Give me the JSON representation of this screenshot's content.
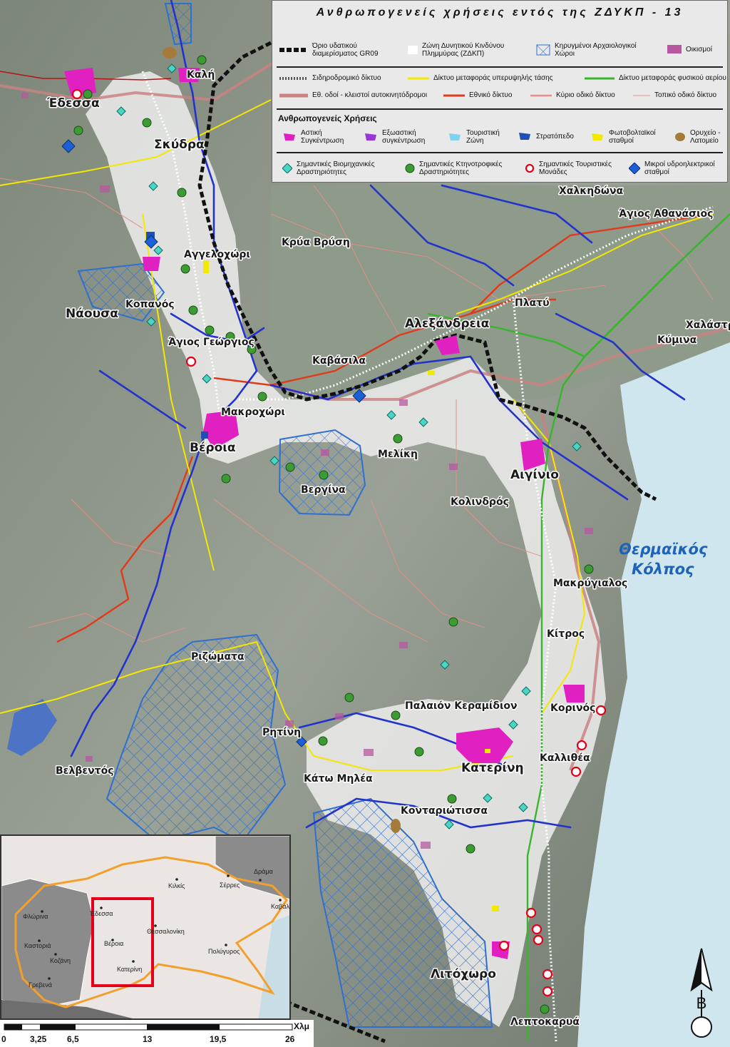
{
  "legend": {
    "title": "Ανθρωπογενείς χρήσεις εντός της ΖΔΥΚΠ - 13",
    "row1": {
      "boundary": "Όριο υδατικού διαμερίσματος GR09",
      "flood_zone": "Ζώνη Δυνητικού Κινδύνου Πλημμύρας (ΖΔΚΠ)",
      "archaeological": "Κηρυγμένοι Αρχαιολογικοί Χώροι",
      "settlements": "Οικισμοί"
    },
    "row2": {
      "railway": "Σιδηροδρομικό δίκτυο",
      "high_voltage": "Δίκτυο μεταφοράς υπερυψηλής τάσης",
      "gas_network": "Δίκτυο μεταφοράς φυσικού αερίου",
      "motorways": "Εθ. οδοί - κλειστοί αυτοκινητόδρομοι",
      "national_network": "Εθνικό δίκτυο",
      "main_roads": "Κύριο οδικό δίκτυο",
      "local_roads": "Τοπικό οδικό δίκτυο"
    },
    "uses_header": "Ανθρωπογενείς Χρήσεις",
    "uses": {
      "urban": "Αστική Συγκέντρωση",
      "suburban": "Εξωαστική συγκέντρωση",
      "tourist": "Τουριστική Ζώνη",
      "military": "Στρατόπεδο",
      "pv": "Φωτοβολταϊκοί σταθμοί",
      "quarry": "Ορυχείο - Λατομείο"
    },
    "points": {
      "industrial": "Σημαντικές Βιομηχανικές Δραστηριότητες",
      "livestock": "Σημαντικές Κτηνοτροφικές Δραστηριότητες",
      "tourism_units": "Σημαντικές Τουριστικές Μονάδες",
      "hydro": "Μικροί υδροηλεκτρικοί σταθμοί"
    },
    "colors": {
      "urban": "#e020c0",
      "suburban": "#9a35d8",
      "tourist": "#7fd3ee",
      "military": "#1f4fb5",
      "pv": "#f3e800",
      "quarry": "#a57b3a",
      "gas": "#37b52b",
      "national": "#e03a1c",
      "river": "#2233cc",
      "sea": "#cfe6ef",
      "flood": "#f0f0f0"
    }
  },
  "places": {
    "edessa": "Έδεσσα",
    "kali": "Καλή",
    "skydra": "Σκύδρα",
    "naousa": "Νάουσα",
    "kopanos": "Κοπανός",
    "agios_georgios": "Άγιος Γεώργιος",
    "aggelochori": "Αγγελοχώρι",
    "kria_vrysi": "Κρύα Βρύση",
    "chalkidona": "Χαλκηδώνα",
    "agios_athanasios": "Άγιος Αθανάσιος",
    "platy": "Πλατύ",
    "chalastra": "Χαλάστρα",
    "kymina": "Κύμινα",
    "alexandreia": "Αλεξάνδρεια",
    "kavasila": "Καβάσιλα",
    "makrochori": "Μακροχώρι",
    "veroia": "Βέροια",
    "meliki": "Μελίκη",
    "vergina": "Βεργίνα",
    "aiginio": "Αιγίνιο",
    "kolindros": "Κολινδρός",
    "makrygialos": "Μακρύγιαλος",
    "kitros": "Κίτρος",
    "rizomata": "Ριζώματα",
    "korinos": "Κορινός",
    "palaion_keramidion": "Παλαιόν Κεραμίδιον",
    "ritini": "Ρητίνη",
    "kallithea": "Καλλιθέα",
    "katerini": "Κατερίνη",
    "velventos": "Βελβεντός",
    "kato_milia": "Κάτω Μηλέα",
    "kontariotissa": "Κονταριώτισσα",
    "litochoro": "Λιτόχωρο",
    "leptokarya": "Λεπτοκαρυά",
    "gulf_line1": "Θερμαϊκός",
    "gulf_line2": "Κόλπος"
  },
  "inset": {
    "florina": "Φλώρινα",
    "kastoria": "Καστοριά",
    "kozani": "Κοζάνη",
    "grevena": "Γρεβενά",
    "edessa": "Έδεσσα",
    "veroia": "Βέροια",
    "katerini": "Κατερίνη",
    "thessaloniki": "Θεσσαλονίκη",
    "kilkis": "Κιλκίς",
    "serres": "Σέρρες",
    "drama": "Δράμα",
    "kavala": "Καβάλ",
    "polygyros": "Πολύγυρος"
  },
  "scale": {
    "ticks": [
      "0",
      "3,25",
      "6,5",
      "13",
      "19,5",
      "26"
    ],
    "unit": "Χλμ"
  },
  "north": {
    "letter": "B"
  }
}
